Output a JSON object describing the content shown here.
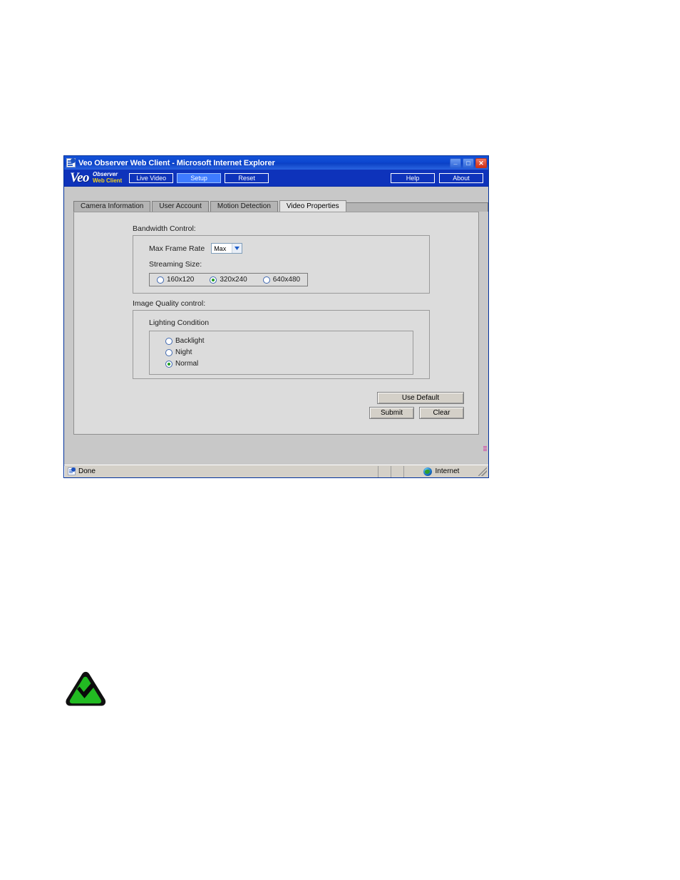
{
  "window": {
    "title": "Veo Observer Web Client - Microsoft Internet Explorer",
    "icon": "ie-document-icon",
    "minimize_label": "_",
    "maximize_label": "□",
    "close_label": "✕"
  },
  "brand": {
    "name": "Veo",
    "product_line1": "Observer",
    "product_line2": "Web Client",
    "name_color": "#ffffff",
    "line2_color": "#f3d21a",
    "bar_color": "#0e33bb"
  },
  "nav": {
    "left_buttons": [
      {
        "label": "Live Video",
        "active": false
      },
      {
        "label": "Setup",
        "active": true
      },
      {
        "label": "Reset",
        "active": false
      }
    ],
    "right_buttons": [
      {
        "label": "Help"
      },
      {
        "label": "About"
      }
    ],
    "active_color": "#3e7bff"
  },
  "tabs": [
    {
      "label": "Camera Information",
      "active": false
    },
    {
      "label": "User Account",
      "active": false
    },
    {
      "label": "Motion Detection",
      "active": false
    },
    {
      "label": "Video Properties",
      "active": true
    }
  ],
  "form": {
    "bandwidth": {
      "legend": "Bandwidth Control:",
      "frame_rate_label": "Max Frame Rate",
      "frame_rate_value": "Max",
      "streaming_size_label": "Streaming Size:",
      "streaming_sizes": [
        {
          "label": "160x120",
          "selected": false
        },
        {
          "label": "320x240",
          "selected": true
        },
        {
          "label": "640x480",
          "selected": false
        }
      ]
    },
    "image_quality": {
      "legend": "Image Quality control:",
      "lighting_title": "Lighting Condition",
      "lighting_options": [
        {
          "label": "Backlight",
          "selected": false
        },
        {
          "label": "Night",
          "selected": false
        },
        {
          "label": "Normal",
          "selected": true
        }
      ]
    },
    "buttons": {
      "use_default": "Use Default",
      "submit": "Submit",
      "clear": "Clear"
    },
    "radio_selected_color": "#1f9e1f",
    "radio_ring_color": "#3f68b0"
  },
  "statusbar": {
    "message": "Done",
    "zone": "Internet",
    "zone_icon": "globe-icon"
  },
  "note": {
    "icon": "green-triangle-check-icon",
    "triangle_color": "#22bb22",
    "border_color": "#101010"
  }
}
